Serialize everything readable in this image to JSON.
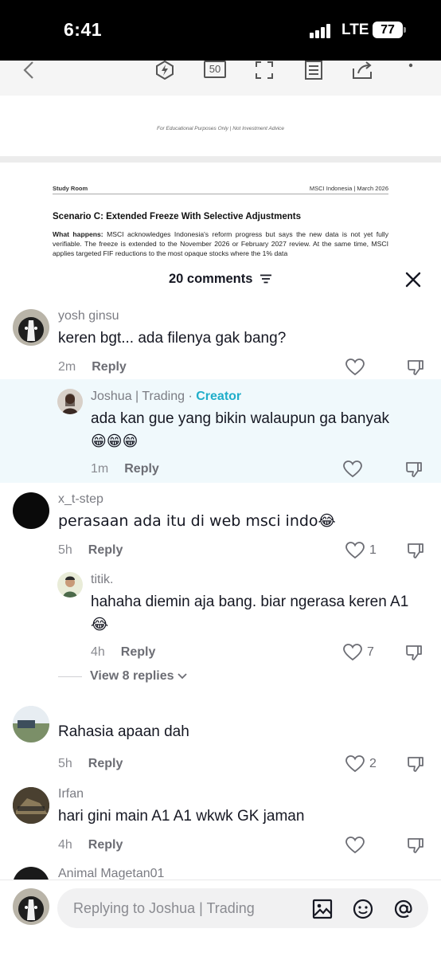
{
  "status_bar": {
    "time": "6:41",
    "network": "LTE",
    "battery": "77"
  },
  "document": {
    "toolbar_icons": [
      "back-icon",
      "flash-icon",
      "page-count-icon",
      "fullscreen-icon",
      "outline-icon",
      "share-icon",
      "more-icon"
    ],
    "page_count": "50",
    "footnote": "For Educational Purposes Only | Not Investment Advice",
    "header_left": "Study Room",
    "header_right": "MSCI Indonesia | March 2026",
    "title": "Scenario C: Extended Freeze With Selective Adjustments",
    "body_label": "What happens:",
    "body_text": "MSCI acknowledges Indonesia's reform progress but says the new data is not yet fully verifiable. The freeze is extended to the November 2026 or February 2027 review. At the same time, MSCI applies targeted FIF reductions to the most opaque stocks where the 1% data"
  },
  "comments_sheet": {
    "title": "20 comments",
    "comments": [
      {
        "username": "yosh ginsu",
        "text": "keren bgt... ada filenya gak bang?",
        "time": "2m",
        "reply_label": "Reply",
        "likes": ""
      },
      {
        "username": "Joshua | Trading",
        "creator_badge": "Creator",
        "text": "ada kan gue yang bikin walaupun ga banyak",
        "emojis": "😁😁😁",
        "time": "1m",
        "reply_label": "Reply",
        "likes": ""
      },
      {
        "username": "x_t-step",
        "text": "perasaan ada itu di web msci indo😂",
        "time": "5h",
        "reply_label": "Reply",
        "likes": "1"
      },
      {
        "username": "titik.",
        "text": "hahaha diemin aja bang. biar ngerasa keren A1",
        "emojis": "😂",
        "time": "4h",
        "reply_label": "Reply",
        "likes": "7"
      },
      {
        "username": "",
        "text": "Rahasia apaan dah",
        "time": "5h",
        "reply_label": "Reply",
        "likes": "2"
      },
      {
        "username": "Irfan",
        "text": "hari gini main A1 A1 wkwk GK jaman",
        "time": "4h",
        "reply_label": "Reply",
        "likes": ""
      },
      {
        "username": "Animal Magetan01"
      }
    ],
    "view_replies": "View 8 replies"
  },
  "input_bar": {
    "placeholder": "Replying to Joshua | Trading"
  },
  "colors": {
    "creator": "#20aeca",
    "reply_highlight": "#f0f9fc",
    "status_bar": "#000000"
  }
}
